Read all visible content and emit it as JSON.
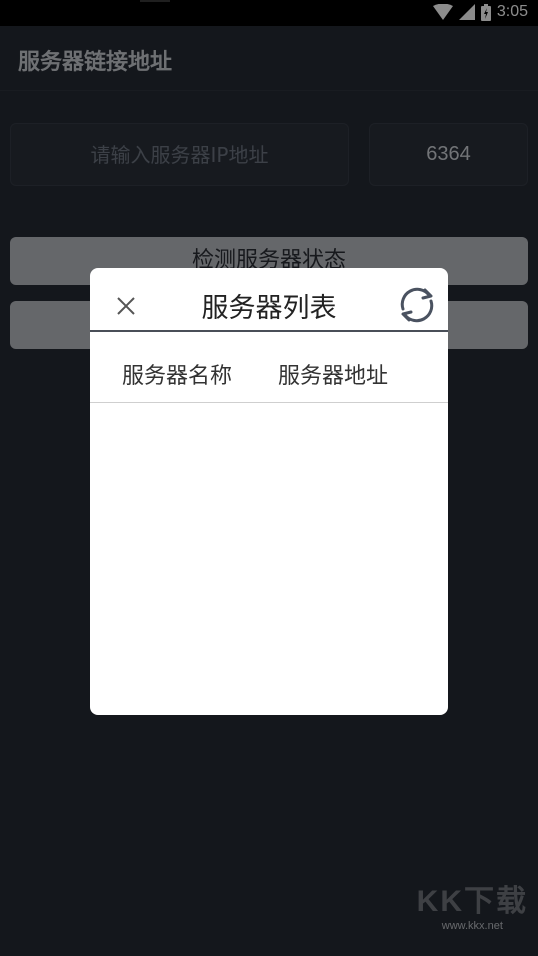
{
  "status_bar": {
    "time": "3:05"
  },
  "app": {
    "title": "服务器链接地址",
    "ip_placeholder": "请输入服务器IP地址",
    "port_value": "6364",
    "check_button_label": "检测服务器状态",
    "list_button_label": ""
  },
  "dialog": {
    "title": "服务器列表",
    "columns": [
      "服务器名称",
      "服务器地址"
    ],
    "rows": []
  },
  "watermark": {
    "logo": "KK下载",
    "url": "www.kkx.net"
  },
  "icons": {
    "close": "close-icon",
    "refresh": "refresh-icon",
    "wifi": "wifi-icon",
    "signal": "signal-icon",
    "battery": "battery-icon"
  },
  "colors": {
    "background": "#252a33",
    "button": "#b9bcc1",
    "dialog": "#ffffff",
    "refresh_icon": "#4a5260"
  }
}
